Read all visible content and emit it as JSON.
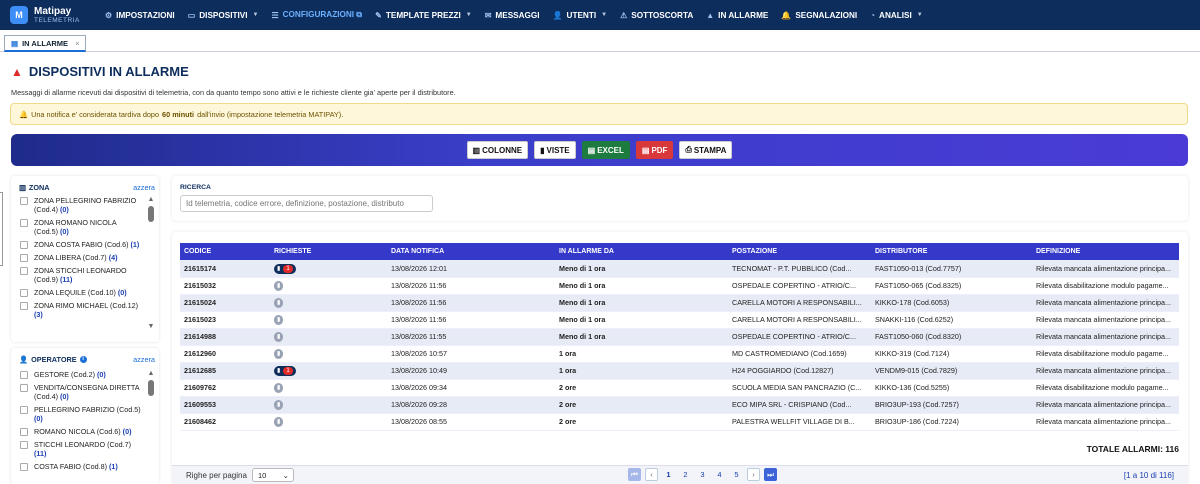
{
  "brand": {
    "logo": "M",
    "name": "Matipay",
    "sub": "TELEMETRIA"
  },
  "nav": [
    {
      "icon": "⚙",
      "label": "IMPOSTAZIONI",
      "caret": false,
      "accent": false
    },
    {
      "icon": "▭",
      "label": "DISPOSITIVI",
      "caret": true,
      "accent": false
    },
    {
      "icon": "☰",
      "label": "CONFIGURAZIONI ⧉",
      "caret": false,
      "accent": true
    },
    {
      "icon": "✎",
      "label": "TEMPLATE PREZZI",
      "caret": true,
      "accent": false
    },
    {
      "icon": "✉",
      "label": "MESSAGGI",
      "caret": false,
      "accent": false
    },
    {
      "icon": "👤",
      "label": "UTENTI",
      "caret": true,
      "accent": false
    },
    {
      "icon": "⚠",
      "label": "SOTTOSCORTA",
      "caret": false,
      "accent": false
    },
    {
      "icon": "▲",
      "label": "IN ALLARME",
      "caret": false,
      "accent": false
    },
    {
      "icon": "🔔",
      "label": "SEGNALAZIONI",
      "caret": false,
      "accent": false
    },
    {
      "icon": "◔",
      "label": "ANALISI",
      "caret": true,
      "accent": false
    }
  ],
  "tab": {
    "label": "IN ALLARME",
    "close": "×"
  },
  "page": {
    "title": "DISPOSITIVI IN ALLARME",
    "subtitle": "Messaggi di allarme ricevuti dai dispositivi di telemetria, con da quanto tempo sono attivi e le richieste cliente gia' aperte per il distributore.",
    "alert_pre": "Una notifica e' considerata tardiva dopo",
    "alert_bold": "60 minuti",
    "alert_post": "dall'invio (impostazione telemetria MATIPAY)."
  },
  "toolbar": {
    "colonne": "COLONNE",
    "viste": "VISTE",
    "excel": "EXCEL",
    "pdf": "PDF",
    "stampa": "STAMPA"
  },
  "zona": {
    "title": "ZONA",
    "reset": "azzera",
    "items": [
      {
        "label": "ZONA PELLEGRINO FABRIZIO (Cod.4)",
        "count": "(0)"
      },
      {
        "label": "ZONA ROMANO NICOLA (Cod.5)",
        "count": "(0)"
      },
      {
        "label": "ZONA COSTA FABIO (Cod.6)",
        "count": "(1)"
      },
      {
        "label": "ZONA LIBERA (Cod.7)",
        "count": "(4)"
      },
      {
        "label": "ZONA STICCHI LEONARDO (Cod.9)",
        "count": "(11)"
      },
      {
        "label": "ZONA LEQUILE (Cod.10)",
        "count": "(0)"
      },
      {
        "label": "ZONA RIMO MICHAEL (Cod.12)",
        "count": "(3)"
      }
    ]
  },
  "operatore": {
    "title": "OPERATORE",
    "reset": "azzera",
    "items": [
      {
        "label": "GESTORE (Cod.2)",
        "count": "(0)"
      },
      {
        "label": "VENDITA/CONSEGNA DIRETTA (Cod.4)",
        "count": "(0)"
      },
      {
        "label": "PELLEGRINO FABRIZIO (Cod.5)",
        "count": "(0)"
      },
      {
        "label": "ROMANO NICOLA (Cod.6)",
        "count": "(0)"
      },
      {
        "label": "STICCHI LEONARDO (Cod.7)",
        "count": "(11)"
      },
      {
        "label": "COSTA FABIO (Cod.8)",
        "count": "(1)"
      }
    ]
  },
  "search": {
    "label": "RICERCA",
    "placeholder": "Id telemetria, codice errore, definizione, postazione, distributo"
  },
  "table": {
    "headers": [
      "CODICE",
      "RICHIESTE",
      "DATA NOTIFICA",
      "IN ALLARME DA",
      "POSTAZIONE",
      "DISTRIBUTORE",
      "DEFINIZIONE"
    ],
    "rows": [
      {
        "codice": "21615174",
        "richieste": "1",
        "data": "13/08/2026 12:01",
        "da": "Meno di 1 ora",
        "postazione": "TECNOMAT - P.T. PUBBLICO (Cod...",
        "distributore": "FAST1050-013 (Cod.7757)",
        "definizione": "Rilevata mancata alimentazione principa..."
      },
      {
        "codice": "21615032",
        "richieste": "",
        "data": "13/08/2026 11:56",
        "da": "Meno di 1 ora",
        "postazione": "OSPEDALE COPERTINO - ATRIO/C...",
        "distributore": "FAST1050-065 (Cod.8325)",
        "definizione": "Rilevata disabilitazione modulo pagame..."
      },
      {
        "codice": "21615024",
        "richieste": "",
        "data": "13/08/2026 11:56",
        "da": "Meno di 1 ora",
        "postazione": "CARELLA MOTORI A RESPONSABILI...",
        "distributore": "KIKKO-178 (Cod.6053)",
        "definizione": "Rilevata mancata alimentazione principa..."
      },
      {
        "codice": "21615023",
        "richieste": "",
        "data": "13/08/2026 11:56",
        "da": "Meno di 1 ora",
        "postazione": "CARELLA MOTORI A RESPONSABILI...",
        "distributore": "SNAKKI-116 (Cod.6252)",
        "definizione": "Rilevata mancata alimentazione principa..."
      },
      {
        "codice": "21614988",
        "richieste": "",
        "data": "13/08/2026 11:55",
        "da": "Meno di 1 ora",
        "postazione": "OSPEDALE COPERTINO - ATRIO/C...",
        "distributore": "FAST1050-060 (Cod.8320)",
        "definizione": "Rilevata mancata alimentazione principa..."
      },
      {
        "codice": "21612960",
        "richieste": "",
        "data": "13/08/2026 10:57",
        "da": "1 ora",
        "postazione": "MD CASTROMEDIANO (Cod.1659)",
        "distributore": "KIKKO-319 (Cod.7124)",
        "definizione": "Rilevata disabilitazione modulo pagame..."
      },
      {
        "codice": "21612685",
        "richieste": "1",
        "data": "13/08/2026 10:49",
        "da": "1 ora",
        "postazione": "H24 POGGIARDO (Cod.12827)",
        "distributore": "VENDM9-015 (Cod.7829)",
        "definizione": "Rilevata mancata alimentazione principa..."
      },
      {
        "codice": "21609762",
        "richieste": "",
        "data": "13/08/2026 09:34",
        "da": "2 ore",
        "postazione": "SCUOLA MEDIA SAN PANCRAZIO (C...",
        "distributore": "KIKKO-136 (Cod.5255)",
        "definizione": "Rilevata disabilitazione modulo pagame..."
      },
      {
        "codice": "21609553",
        "richieste": "",
        "data": "13/08/2026 09:28",
        "da": "2 ore",
        "postazione": "ECO MIPA SRL - CRISPIANO (Cod...",
        "distributore": "BRIO3UP-193 (Cod.7257)",
        "definizione": "Rilevata mancata alimentazione principa..."
      },
      {
        "codice": "21608462",
        "richieste": "",
        "data": "13/08/2026 08:55",
        "da": "2 ore",
        "postazione": "PALESTRA WELLFIT VILLAGE DI B...",
        "distributore": "BRIO3UP-186 (Cod.7224)",
        "definizione": "Rilevata mancata alimentazione principa..."
      }
    ],
    "total": "TOTALE ALLARMI: 116"
  },
  "footer": {
    "rows_label": "Righe per pagina",
    "rows_value": "10",
    "pages": [
      "1",
      "2",
      "3",
      "4",
      "5"
    ],
    "prev": "‹",
    "next": "›",
    "range": "[1 a 10 di 116]"
  }
}
